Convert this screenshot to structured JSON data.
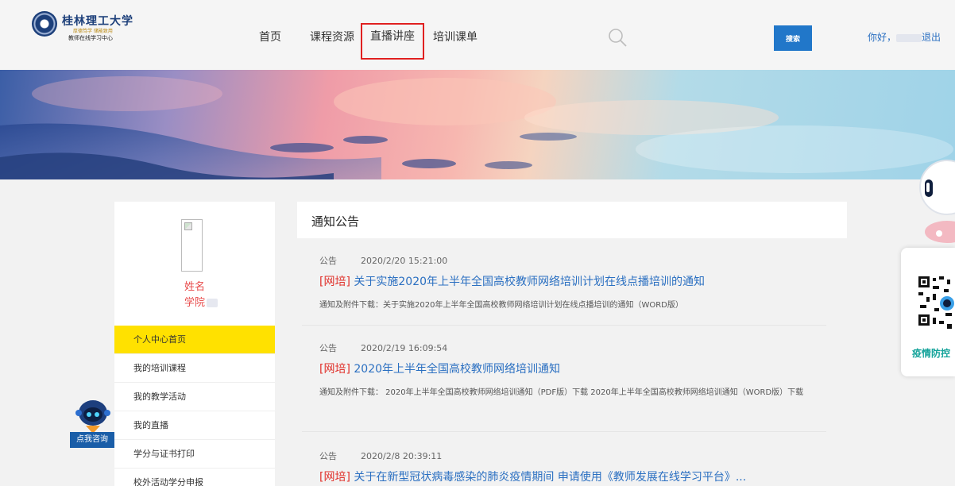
{
  "header": {
    "logo": {
      "name": "桂林理工大学",
      "motto": "厚德笃学 储能致用",
      "subtitle": "教师在线学习中心"
    },
    "nav": [
      {
        "label": "首页",
        "active": false
      },
      {
        "label": "课程资源",
        "active": false
      },
      {
        "label": "直播讲座",
        "active": true
      },
      {
        "label": "培训课单",
        "active": false
      }
    ],
    "search": {
      "placeholder": "",
      "button_label": "搜索"
    },
    "user": {
      "greeting": "你好，",
      "logout": "退出"
    }
  },
  "sidebar": {
    "profile": {
      "name_label": "姓名",
      "college_label": "学院"
    },
    "menu": [
      {
        "label": "个人中心首页",
        "active": true
      },
      {
        "label": "我的培训课程",
        "active": false
      },
      {
        "label": "我的教学活动",
        "active": false
      },
      {
        "label": "我的直播",
        "active": false
      },
      {
        "label": "学分与证书打印",
        "active": false
      },
      {
        "label": "校外活动学分申报",
        "active": false
      }
    ]
  },
  "main": {
    "title": "通知公告",
    "notices": [
      {
        "category": "公告",
        "datetime": "2020/2/20 15:21:00",
        "tag": "[网培]",
        "title": "关于实施2020年上半年全国高校教师网络培训计划在线点播培训的通知",
        "attachment": "通知及附件下载：关于实施2020年上半年全国高校教师网络培训计划在线点播培训的通知（WORD版）"
      },
      {
        "category": "公告",
        "datetime": "2020/2/19 16:09:54",
        "tag": "[网培]",
        "title": "2020年上半年全国高校教师网络培训通知",
        "attachment": "通知及附件下载： 2020年上半年全国高校教师网络培训通知（PDF版）下载 2020年上半年全国高校教师网络培训通知（WORD版）下载"
      },
      {
        "category": "公告",
        "datetime": "2020/2/8 20:39:11",
        "tag": "[网培]",
        "title": "关于在新型冠状病毒感染的肺炎疫情期间 申请使用《教师发展在线学习平台》...",
        "attachment": ""
      }
    ]
  },
  "widgets": {
    "consult_label": "点我咨询",
    "epidemic_label": "疫情防控"
  },
  "colors": {
    "accent_blue": "#2177c9",
    "link_blue": "#2a6fc1",
    "tag_red": "#e0312b",
    "active_menu": "#ffe100",
    "nav_highlight": "#e02020",
    "epidemic_green": "#14a39a"
  },
  "icons": {
    "search": "search-icon",
    "avatar": "broken-image-icon",
    "robot": "robot-mascot-icon",
    "qr": "qr-code-icon"
  }
}
